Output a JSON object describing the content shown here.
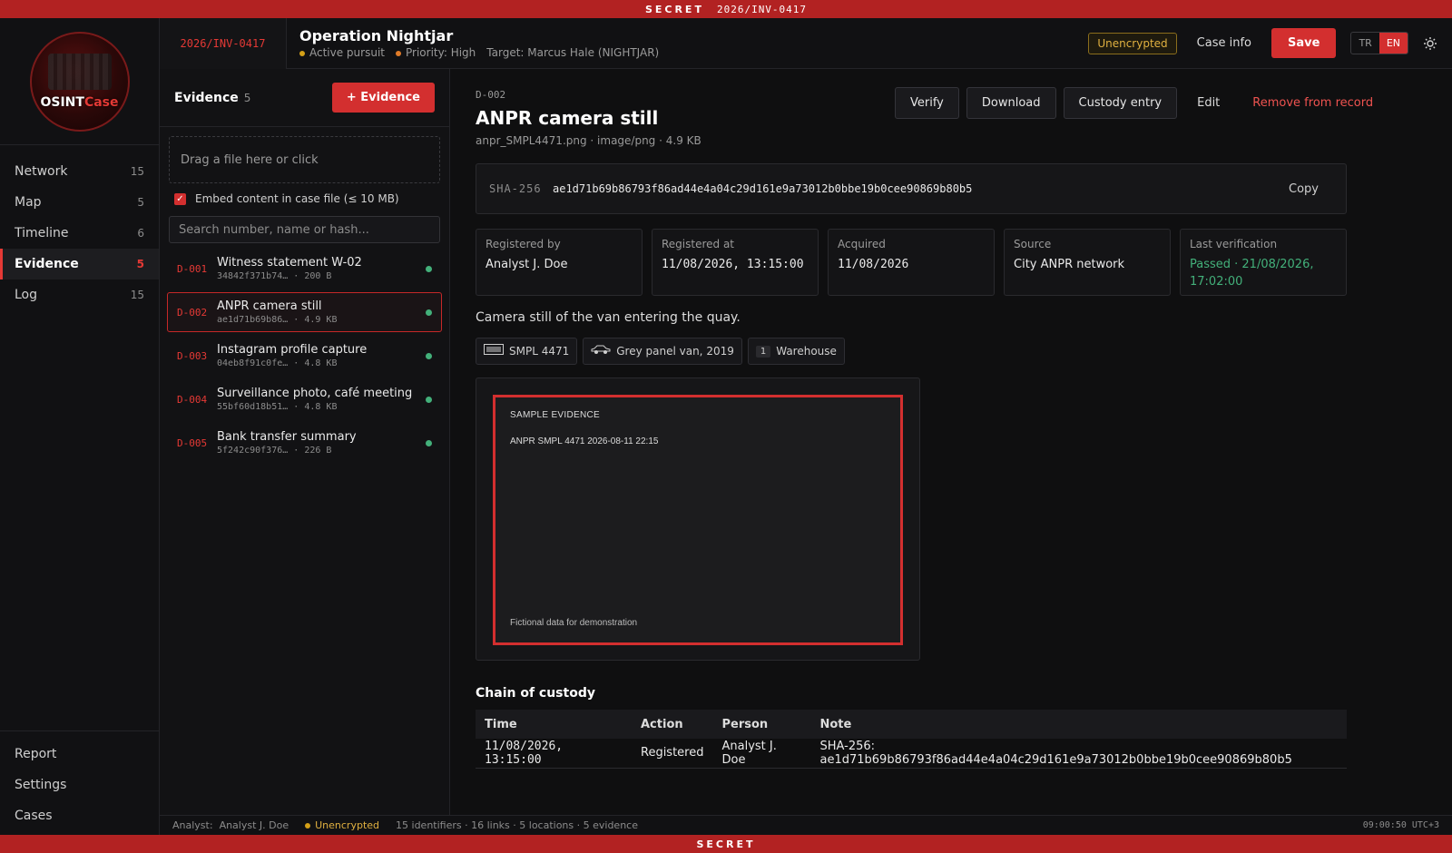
{
  "banner": {
    "level": "SECRET",
    "case_code": "2026/INV-0417",
    "bottom_level": "SECRET"
  },
  "app": {
    "logo_text_a": "OSINT",
    "logo_text_b": "Case"
  },
  "sidebar": {
    "items": [
      {
        "label": "Network",
        "count": "15"
      },
      {
        "label": "Map",
        "count": "5"
      },
      {
        "label": "Timeline",
        "count": "6"
      },
      {
        "label": "Evidence",
        "count": "5",
        "active": true
      },
      {
        "label": "Log",
        "count": "15"
      }
    ],
    "bottom": [
      "Report",
      "Settings",
      "Cases"
    ]
  },
  "header": {
    "case_id": "2026/INV-0417",
    "title": "Operation Nightjar",
    "status": "Active pursuit",
    "priority": "Priority: High",
    "target": "Target: Marcus Hale (NIGHTJAR)",
    "encryption_badge": "Unencrypted",
    "case_info": "Case info",
    "save": "Save",
    "lang_tr": "TR",
    "lang_en": "EN",
    "theme_icon": "sun-icon"
  },
  "evidence_panel": {
    "title": "Evidence",
    "count": "5",
    "add_button": "+ Evidence",
    "dropzone": "Drag a file here or click",
    "embed_label": "Embed content in case file (≤ 10 MB)",
    "embed_checked": true,
    "search_placeholder": "Search number, name or hash...",
    "items": [
      {
        "id": "D-001",
        "name": "Witness statement W-02",
        "hash": "34842f371b74…",
        "size": "200 B"
      },
      {
        "id": "D-002",
        "name": "ANPR camera still",
        "hash": "ae1d71b69b86…",
        "size": "4.9 KB",
        "selected": true
      },
      {
        "id": "D-003",
        "name": "Instagram profile capture",
        "hash": "04eb8f91c0fe…",
        "size": "4.8 KB"
      },
      {
        "id": "D-004",
        "name": "Surveillance photo, café meeting",
        "hash": "55bf60d18b51…",
        "size": "4.8 KB"
      },
      {
        "id": "D-005",
        "name": "Bank transfer summary",
        "hash": "5f242c90f376…",
        "size": "226 B"
      }
    ]
  },
  "detail": {
    "id": "D-002",
    "title": "ANPR camera still",
    "file_info": "anpr_SMPL4471.png · image/png · 4.9 KB",
    "actions": {
      "verify": "Verify",
      "download": "Download",
      "custody": "Custody entry",
      "edit": "Edit",
      "remove": "Remove from record"
    },
    "hash_label": "SHA-256",
    "hash_value": "ae1d71b69b86793f86ad44e4a04c29d161e9a73012b0bbe19b0cee90869b80b5",
    "copy": "Copy",
    "meta": [
      {
        "label": "Registered by",
        "value": "Analyst J. Doe"
      },
      {
        "label": "Registered at",
        "value": "11/08/2026, 13:15:00"
      },
      {
        "label": "Acquired",
        "value": "11/08/2026"
      },
      {
        "label": "Source",
        "value": "City ANPR network"
      },
      {
        "label": "Last verification",
        "value": "Passed · 21/08/2026, 17:02:00"
      }
    ],
    "description": "Camera still of the van entering the quay.",
    "chips": [
      {
        "icon": "license-plate-icon",
        "label": "SMPL 4471"
      },
      {
        "icon": "car-icon",
        "label": "Grey panel van, 2019"
      },
      {
        "num": "1",
        "label": "Warehouse"
      }
    ],
    "preview": {
      "line1": "SAMPLE EVIDENCE",
      "line2": "ANPR SMPL 4471 2026-08-11 22:15",
      "footer": "Fictional data for demonstration"
    },
    "custody_title": "Chain of custody",
    "custody_headers": [
      "Time",
      "Action",
      "Person",
      "Note"
    ],
    "custody_rows": [
      [
        "11/08/2026, 13:15:00",
        "Registered",
        "Analyst J. Doe",
        "SHA-256: ae1d71b69b86793f86ad44e4a04c29d161e9a73012b0bbe19b0cee90869b80b5"
      ]
    ]
  },
  "statusbar": {
    "analyst_label": "Analyst:",
    "analyst": "Analyst J. Doe",
    "encryption": "Unencrypted",
    "summary": "15 identifiers · 16 links · 5 locations · 5 evidence",
    "clock": "09:00:50 UTC+3"
  },
  "colors": {
    "accent": "#d32f2f",
    "ok": "#43b07a",
    "warning": "#e0b040"
  }
}
